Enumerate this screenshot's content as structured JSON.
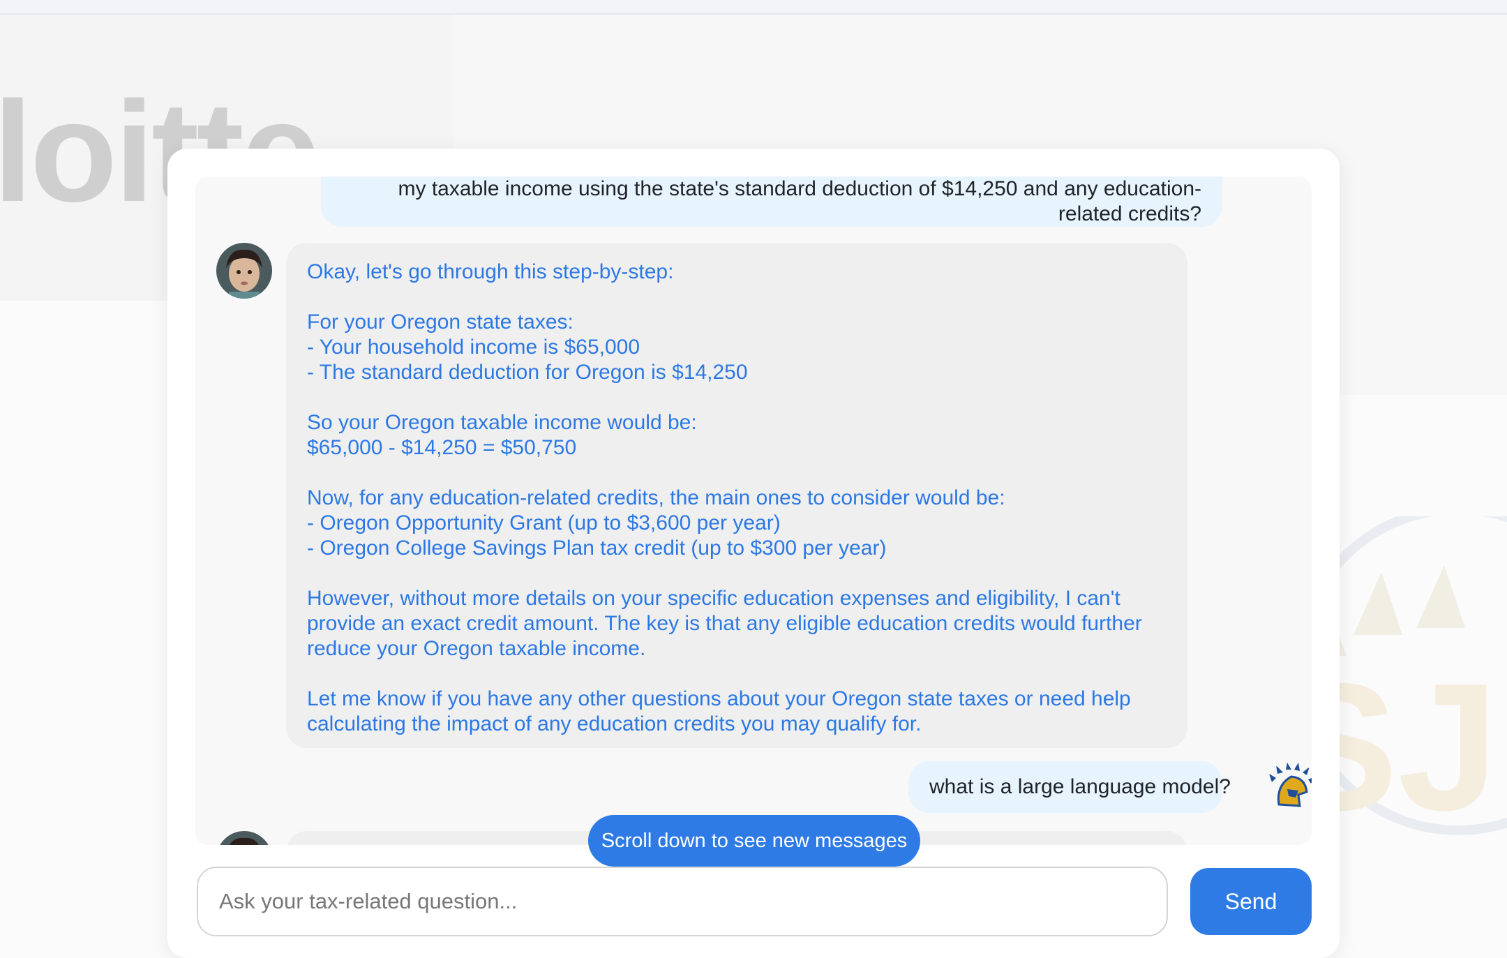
{
  "background": {
    "logo_fragment": "loitte"
  },
  "chat": {
    "user_message_prev": {
      "line1": "my taxable income using the state's standard deduction of $14,250 and any education-",
      "line2": "related credits?"
    },
    "assistant_message": {
      "lines": [
        "Okay, let's go through this step-by-step:",
        "",
        "For your Oregon state taxes:",
        "- Your household income is $65,000",
        "- The standard deduction for Oregon is $14,250",
        "",
        "So your Oregon taxable income would be:",
        "$65,000 - $14,250 = $50,750",
        "",
        "Now, for any education-related credits, the main ones to consider would be:",
        "- Oregon Opportunity Grant (up to $3,600 per year)",
        "- Oregon College Savings Plan tax credit (up to $300 per year)",
        "",
        "However, without more details on your specific education expenses and eligibility, I can't",
        "provide an exact credit amount. The key is that any eligible education credits would further",
        "reduce your Oregon taxable income.",
        "",
        "Let me know if you have any other questions about your Oregon state taxes or need help",
        "calculating the impact of any education credits you may qualify for."
      ]
    },
    "user_message_latest": "what is a large language model?",
    "scroll_notice": "Scroll down to see new messages"
  },
  "composer": {
    "placeholder": "Ask your tax-related question...",
    "value": "",
    "send_label": "Send"
  },
  "colors": {
    "accent": "#2e7be5",
    "assistant_text": "#2c78e4",
    "user_bubble": "#e7f4fe",
    "assistant_bubble": "#efefef"
  },
  "icons": {
    "assistant_avatar": "child-photo-avatar",
    "user_avatar": "spartan-helmet-avatar"
  }
}
